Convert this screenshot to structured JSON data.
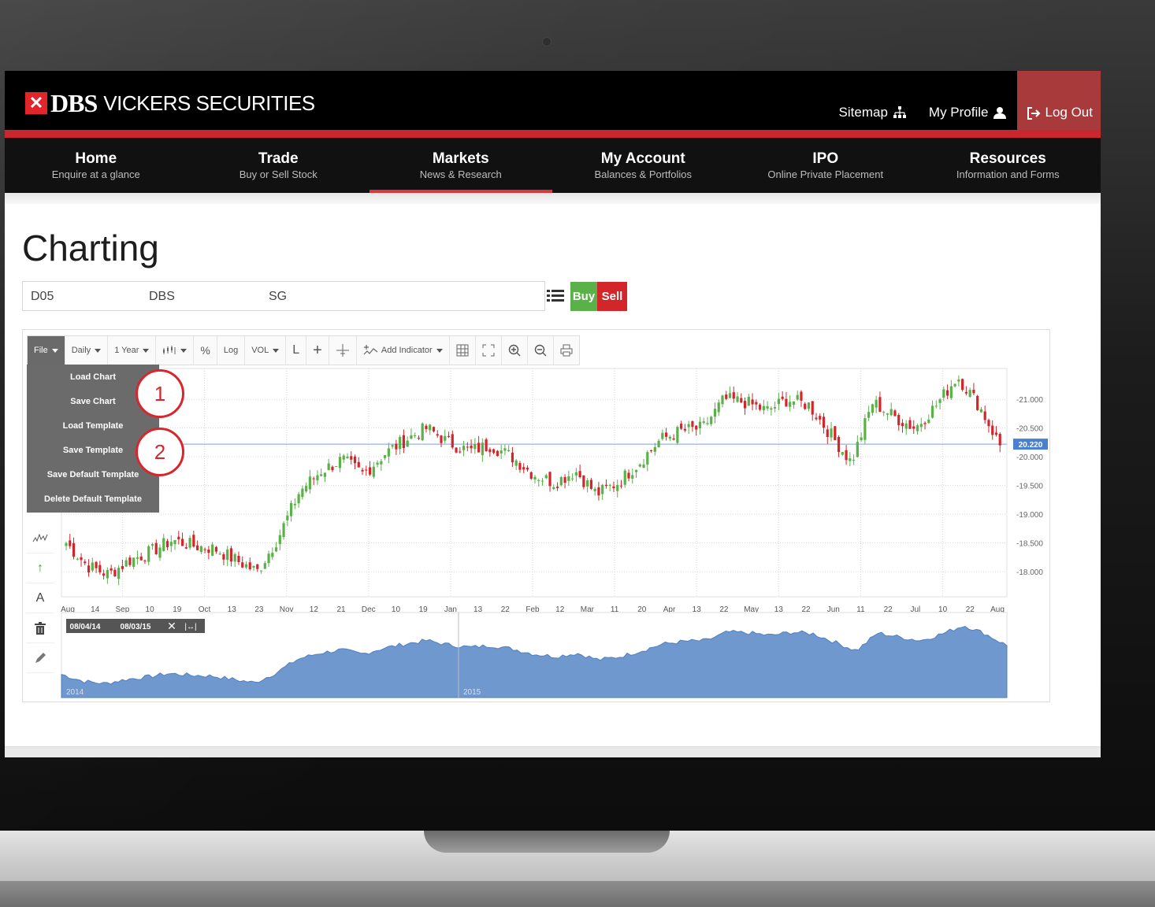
{
  "header": {
    "logo_mark": "✕",
    "logo_brand": "DBS",
    "logo_sub": "VICKERS SECURITIES",
    "links": [
      {
        "label": "Sitemap",
        "icon": "sitemap-icon"
      },
      {
        "label": "My Profile",
        "icon": "user-icon"
      }
    ],
    "logout_label": "Log Out"
  },
  "nav": [
    {
      "title": "Home",
      "subtitle": "Enquire at a glance"
    },
    {
      "title": "Trade",
      "subtitle": "Buy or Sell Stock"
    },
    {
      "title": "Markets",
      "subtitle": "News & Research"
    },
    {
      "title": "My Account",
      "subtitle": "Balances & Portfolios"
    },
    {
      "title": "IPO",
      "subtitle": "Online Private Placement"
    },
    {
      "title": "Resources",
      "subtitle": "Information and Forms"
    }
  ],
  "page": {
    "title": "Charting"
  },
  "symbol": {
    "code": "D05",
    "name": "DBS",
    "market": "SG",
    "buy_label": "Buy",
    "sell_label": "Sell"
  },
  "toolbar": {
    "file": "File",
    "interval": "Daily",
    "range": "1 Year",
    "percent": "%",
    "log": "Log",
    "vol": "VOL",
    "line_tool": "L",
    "add_indicator": "Add Indicator"
  },
  "file_menu": [
    "Load Chart",
    "Save Chart",
    "Load Template",
    "Save Template",
    "Save Default Template",
    "Delete Default Template"
  ],
  "callouts": [
    "1",
    "2"
  ],
  "navigator": {
    "start_date": "08/04/14",
    "end_date": "08/03/15",
    "year_labels": [
      "2014",
      "2015"
    ]
  },
  "colors": {
    "brand_red": "#c9262d",
    "up": "#5ab14a",
    "down": "#d2262b",
    "area": "#6f98cf"
  },
  "chart_data": {
    "type": "candlestick",
    "y_ticks": [
      "21.000",
      "20.500",
      "20.000",
      "19.500",
      "19.000",
      "18.500",
      "18.000"
    ],
    "ylim": [
      17.7,
      21.4
    ],
    "last_price": "20.220",
    "x_tick_labels": [
      "Aug",
      "14",
      "Sep",
      "10",
      "19",
      "Oct",
      "13",
      "23",
      "Nov",
      "12",
      "21",
      "Dec",
      "10",
      "19",
      "Jan",
      "13",
      "22",
      "Feb",
      "12",
      "Mar",
      "11",
      "20",
      "Apr",
      "13",
      "22",
      "May",
      "13",
      "22",
      "Jun",
      "11",
      "22",
      "Jul",
      "10",
      "22",
      "Aug"
    ],
    "close_series_approx": [
      18.5,
      18.1,
      17.95,
      18.2,
      18.35,
      18.55,
      18.45,
      18.4,
      18.2,
      18.0,
      18.6,
      19.4,
      19.75,
      19.95,
      19.7,
      20.05,
      20.3,
      20.5,
      20.25,
      20.1,
      20.2,
      20.0,
      19.7,
      19.55,
      19.75,
      19.35,
      19.55,
      19.9,
      20.3,
      20.45,
      20.5,
      21.0,
      20.95,
      20.8,
      21.0,
      20.9,
      20.4,
      19.9,
      20.95,
      20.7,
      20.5,
      20.9,
      21.4,
      20.9,
      20.2
    ],
    "grid": true,
    "legend": "none"
  }
}
